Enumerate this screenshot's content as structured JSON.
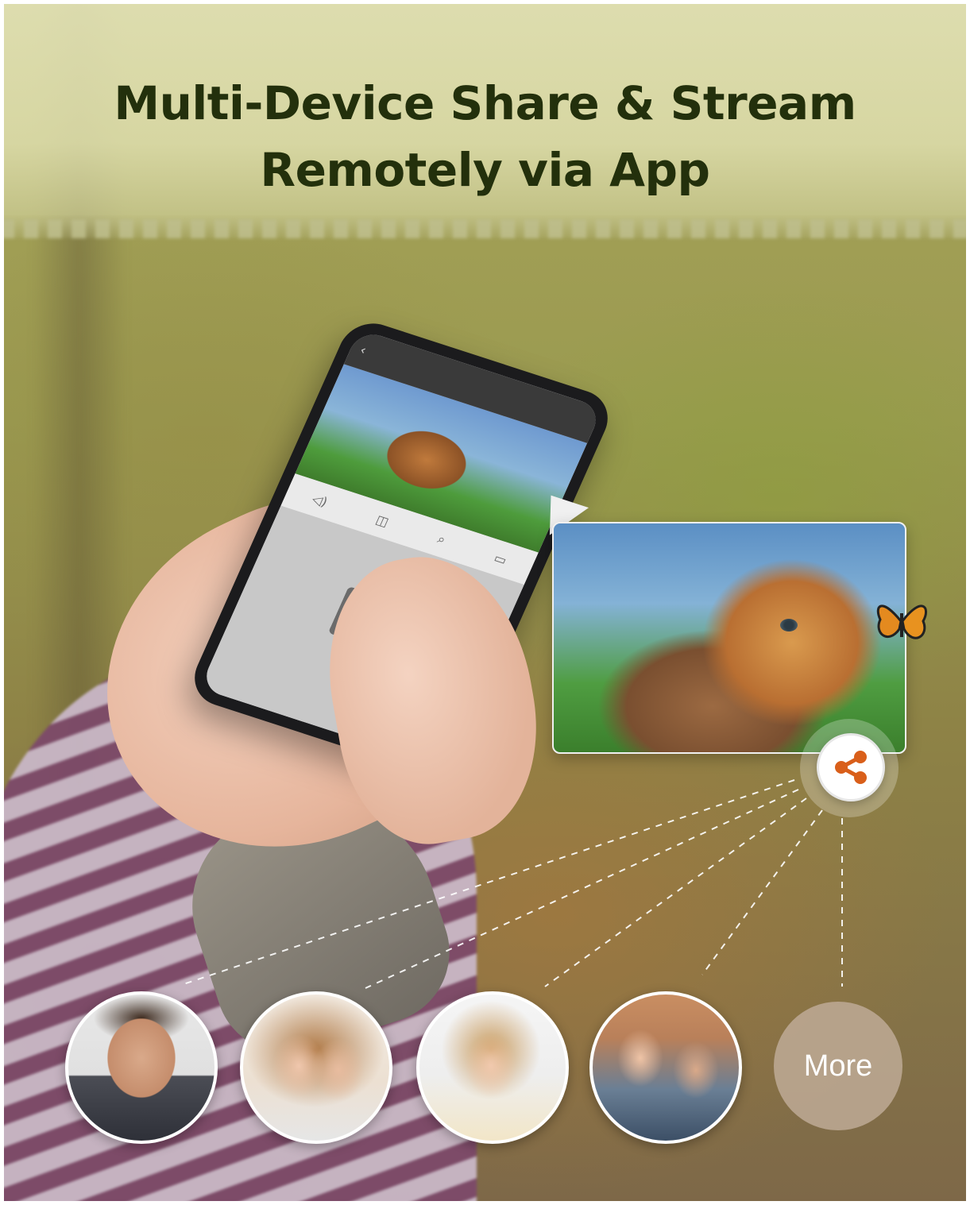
{
  "title_line1": "Multi-Device Share & Stream",
  "title_line2": "Remotely via App",
  "more_label": "More",
  "icons": {
    "share": "share-icon",
    "back": "chevron-left-icon",
    "settings": "gear-icon"
  },
  "colors": {
    "title": "#23300c",
    "share_accent": "#d95f1a"
  }
}
